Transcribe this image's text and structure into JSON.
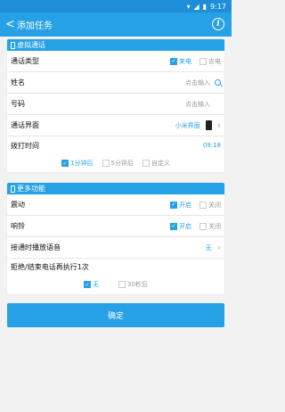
{
  "status": {
    "time": "9:17"
  },
  "header": {
    "title": "添加任务",
    "info_icon": "info-icon"
  },
  "card1": {
    "title": "虚拟通话",
    "call_type": {
      "label": "通话类型",
      "opt1": "来电",
      "opt2": "去电"
    },
    "name": {
      "label": "姓名",
      "placeholder": "点击输入"
    },
    "number": {
      "label": "号码",
      "placeholder": "点击输入"
    },
    "interface": {
      "label": "通话界面",
      "value": "小米界面"
    },
    "dial_time": {
      "label": "拨打时间",
      "value": "09:18"
    },
    "delay_options": [
      "1分钟后",
      "5分钟后",
      "自定义"
    ]
  },
  "card2": {
    "title": "更多功能",
    "vibrate": {
      "label": "震动",
      "on": "开启",
      "off": "关闭"
    },
    "ring": {
      "label": "响铃",
      "on": "开启",
      "off": "关闭"
    },
    "voice": {
      "label": "接通时播放语音",
      "value": "无"
    },
    "repeat": {
      "label": "拒绝/结束电话再执行1次",
      "opt1": "无",
      "opt2": "30秒后"
    }
  },
  "confirm_label": "确定",
  "colors": {
    "accent": "#27a1e6",
    "statusbar": "#1e8fd6"
  }
}
